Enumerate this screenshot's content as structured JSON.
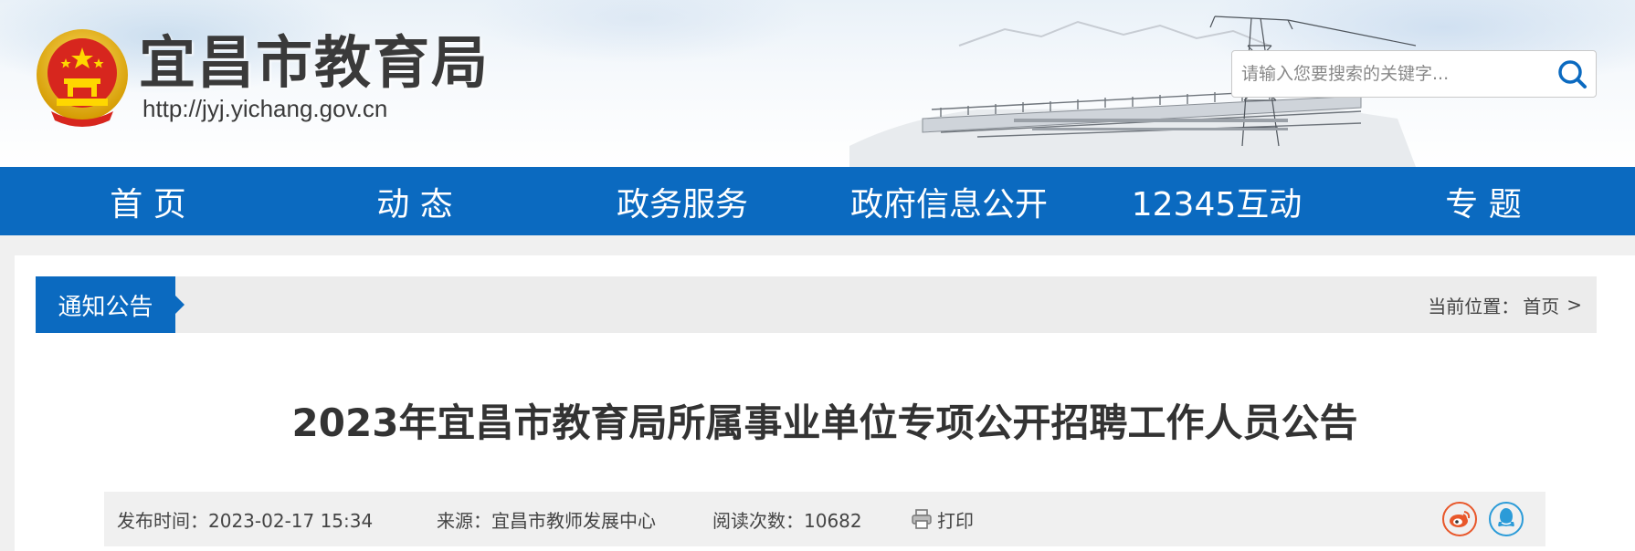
{
  "header": {
    "site_title": "宜昌市教育局",
    "site_url": "http://jyj.yichang.gov.cn",
    "search": {
      "placeholder": "请输入您要搜索的关键字...",
      "value": ""
    }
  },
  "nav": {
    "items": [
      {
        "label": "首 页"
      },
      {
        "label": "动 态"
      },
      {
        "label": "政务服务"
      },
      {
        "label": "政府信息公开"
      },
      {
        "label": "12345互动"
      },
      {
        "label": "专 题"
      }
    ]
  },
  "category": {
    "tab_label": "通知公告",
    "breadcrumb_prefix": "当前位置：",
    "breadcrumb_home": "首页",
    "breadcrumb_sep": ">"
  },
  "article": {
    "title": "2023年宜昌市教育局所属事业单位专项公开招聘工作人员公告",
    "publish_time": "发布时间：2023-02-17 15:34",
    "source": "来源：宜昌市教师发展中心",
    "read_count": "阅读次数：10682",
    "print_label": "打印"
  },
  "share": {
    "weibo_icon": "weibo-icon",
    "qq_icon": "qq-icon"
  },
  "colors": {
    "nav_blue": "#0b6ac0",
    "weibo_orange": "#e8572a",
    "qq_blue": "#2b9bd8"
  }
}
